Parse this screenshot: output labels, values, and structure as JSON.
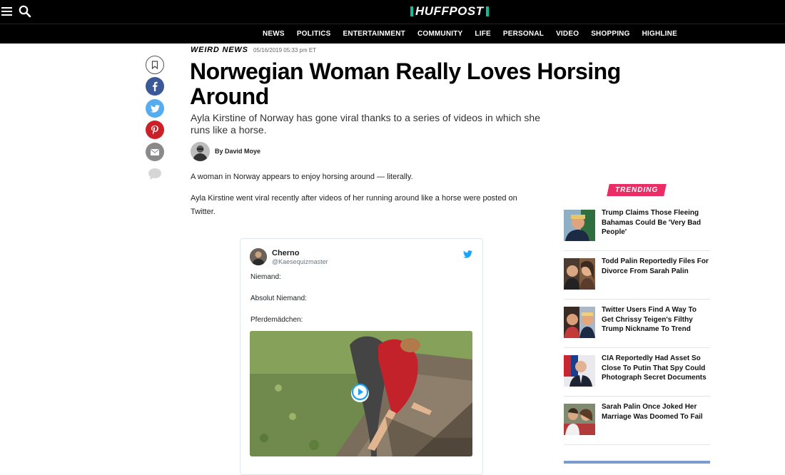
{
  "header": {
    "logo_text": "HUFFPOST",
    "nav": [
      "NEWS",
      "POLITICS",
      "ENTERTAINMENT",
      "COMMUNITY",
      "LIFE",
      "PERSONAL",
      "VIDEO",
      "SHOPPING",
      "HIGHLINE"
    ]
  },
  "article": {
    "section": "WEIRD NEWS",
    "date": "05/16/2019 05:33 pm ET",
    "headline": "Norwegian Woman Really Loves Horsing Around",
    "dek": "Ayla Kirstine of Norway has gone viral thanks to a series of videos in which she runs like a horse.",
    "byline": "By David Moye",
    "paragraphs": [
      "A woman in Norway appears to enjoy horsing around — literally.",
      "Ayla Kirstine went viral recently after videos of her running around like a horse were posted on Twitter."
    ]
  },
  "tweet": {
    "name": "Cherno",
    "handle": "@Kaesequizmaster",
    "lines": [
      "Niemand:",
      "Absolut Niemand:",
      "Pferdemädchen:"
    ]
  },
  "trending": {
    "label": "TRENDING",
    "items": [
      {
        "title": "Trump Claims Those Fleeing Bahamas Could Be 'Very Bad People'"
      },
      {
        "title": "Todd Palin Reportedly Files For Divorce From Sarah Palin"
      },
      {
        "title": "Twitter Users Find A Way To Get Chrissy Teigen's Filthy Trump Nickname To Trend"
      },
      {
        "title": "CIA Reportedly Had Asset So Close To Putin That Spy Could Photograph Secret Documents"
      },
      {
        "title": "Sarah Palin Once Joked Her Marriage Was Doomed To Fail"
      }
    ]
  },
  "icons": {
    "menu": "hamburger-icon",
    "search": "search-icon",
    "share": [
      "bookmark-icon",
      "facebook-icon",
      "twitter-icon",
      "pinterest-icon",
      "email-icon",
      "comment-icon"
    ]
  },
  "colors": {
    "header_bg": "#000000",
    "logo_accent": "#0dbe98",
    "trending": "#ec2c65",
    "facebook": "#3b5998",
    "twitter": "#55acee",
    "pinterest": "#cb2027"
  }
}
